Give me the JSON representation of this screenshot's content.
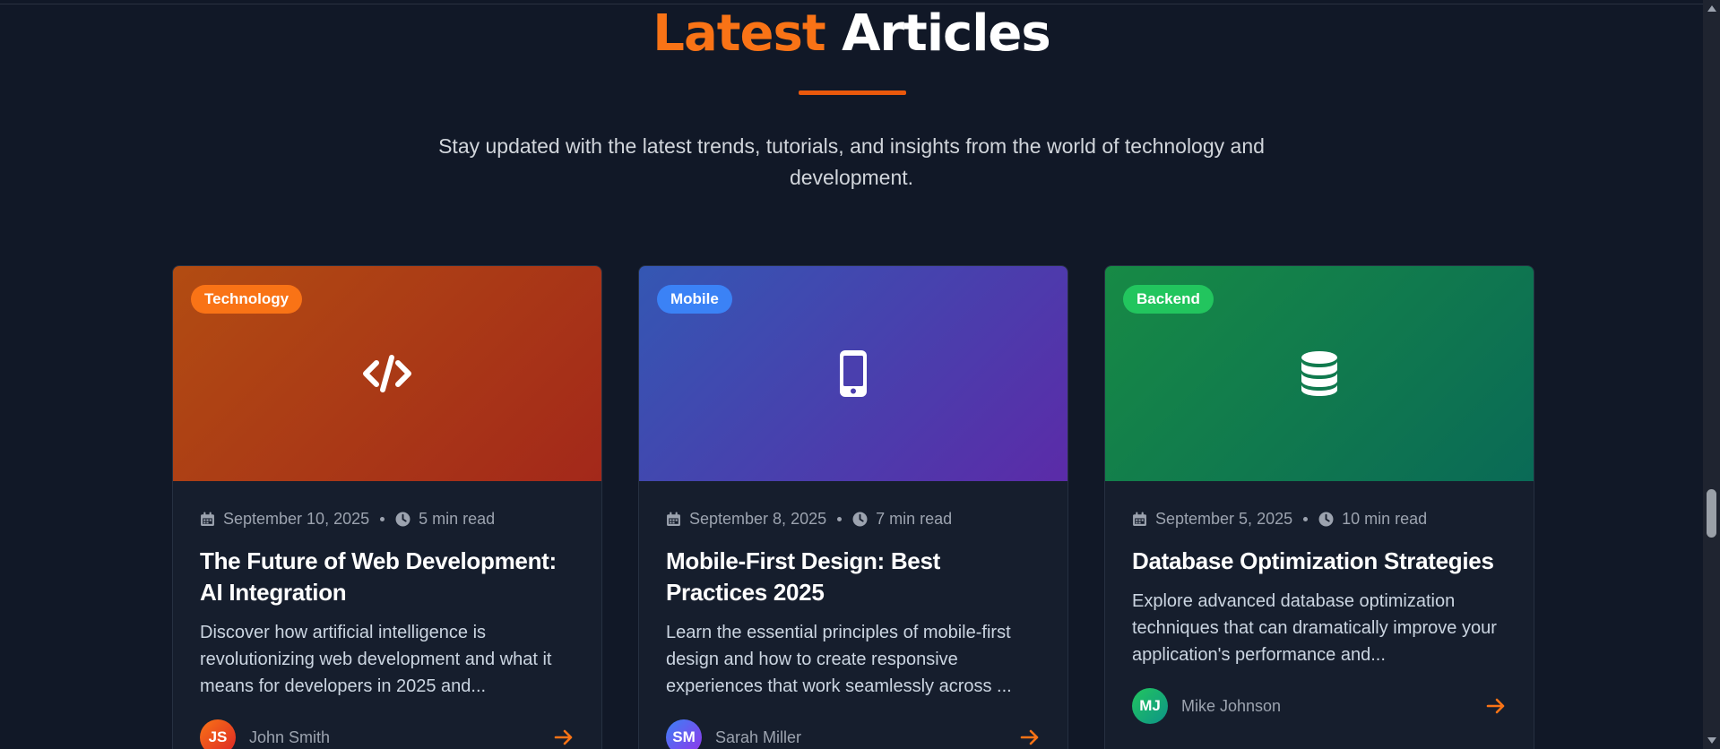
{
  "section": {
    "title_accent": "Latest",
    "title_rest": "Articles",
    "subtitle": "Stay updated with the latest trends, tutorials, and insights from the world of technology and development."
  },
  "articles": [
    {
      "category": "Technology",
      "icon": "code-icon",
      "date": "September 10, 2025",
      "read_time": "5 min read",
      "title": "The Future of Web Development: AI Integration",
      "excerpt": "Discover how artificial intelligence is revolutionizing web development and what it means for developers in 2025 and...",
      "author_initials": "JS",
      "author_name": "John Smith"
    },
    {
      "category": "Mobile",
      "icon": "mobile-phone-icon",
      "date": "September 8, 2025",
      "read_time": "7 min read",
      "title": "Mobile-First Design: Best Practices 2025",
      "excerpt": "Learn the essential principles of mobile-first design and how to create responsive experiences that work seamlessly across ...",
      "author_initials": "SM",
      "author_name": "Sarah Miller"
    },
    {
      "category": "Backend",
      "icon": "database-icon",
      "date": "September 5, 2025",
      "read_time": "10 min read",
      "title": "Database Optimization Strategies",
      "excerpt": "Explore advanced database optimization techniques that can dramatically improve your application's performance and...",
      "author_initials": "MJ",
      "author_name": "Mike Johnson"
    }
  ],
  "colors": {
    "background": "#111827",
    "accent": "#f97316",
    "card": "#161e2d",
    "technology": "#f97316",
    "mobile": "#3b82f6",
    "backend": "#22c55e"
  }
}
